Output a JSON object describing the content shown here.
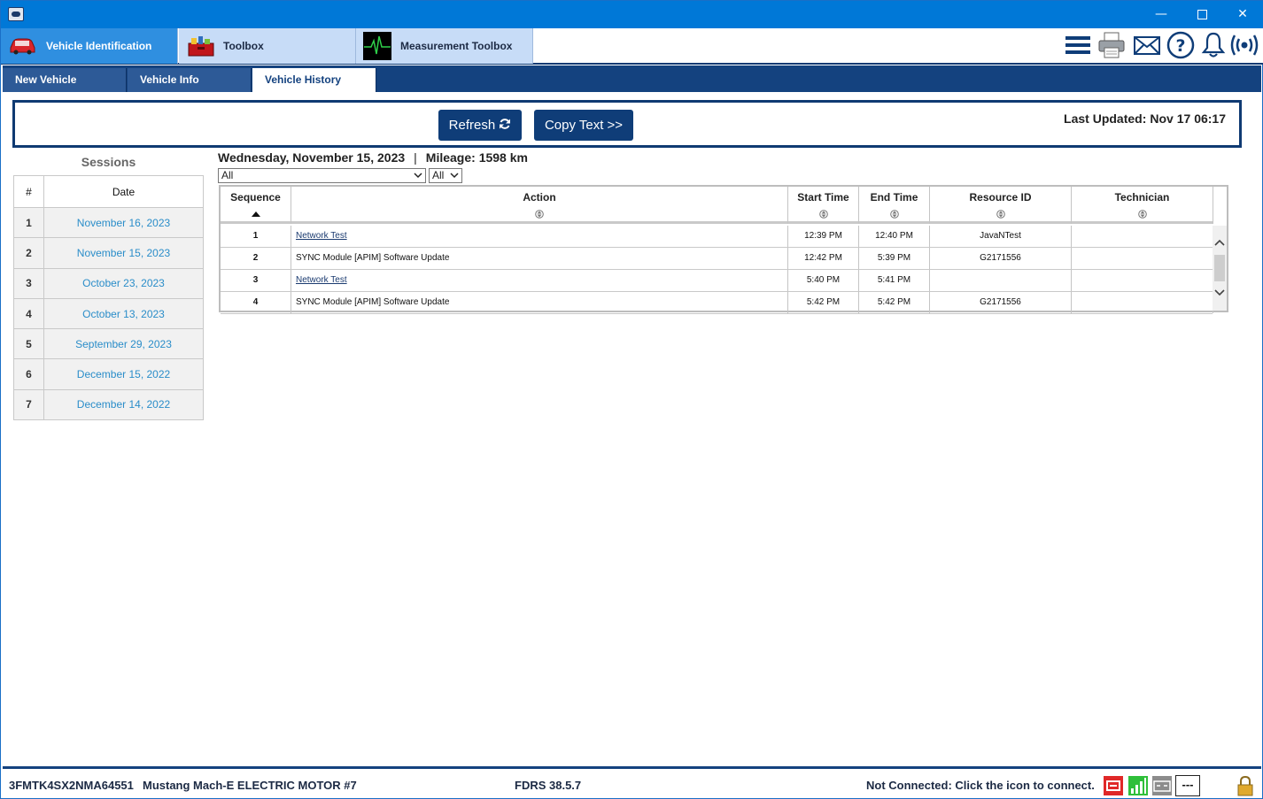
{
  "window": {
    "minimize": "—",
    "close": "✕"
  },
  "main_tabs": [
    {
      "label": "Vehicle Identification",
      "icon": "car-icon",
      "active": true
    },
    {
      "label": "Toolbox",
      "icon": "toolbox-icon",
      "active": false
    },
    {
      "label": "Measurement Toolbox",
      "icon": "ecg-icon",
      "active": false
    }
  ],
  "top_icons": [
    "menu-icon",
    "printer-icon",
    "mail-icon",
    "help-icon",
    "bell-icon",
    "wireless-icon"
  ],
  "sub_tabs": [
    {
      "label": "New Vehicle",
      "active": false
    },
    {
      "label": "Vehicle Info",
      "active": false
    },
    {
      "label": "Vehicle History",
      "active": true
    }
  ],
  "toolbar": {
    "refresh_label": "Refresh",
    "copy_label": "Copy Text >>",
    "last_updated_label": "Last Updated:",
    "last_updated_value": "Nov 17 06:17"
  },
  "sessions": {
    "title": "Sessions",
    "col_num": "#",
    "col_date": "Date",
    "rows": [
      {
        "num": "1",
        "date": "November 16, 2023"
      },
      {
        "num": "2",
        "date": "November 15, 2023"
      },
      {
        "num": "3",
        "date": "October 23, 2023"
      },
      {
        "num": "4",
        "date": "October 13, 2023"
      },
      {
        "num": "5",
        "date": "September 29, 2023"
      },
      {
        "num": "6",
        "date": "December 15, 2022"
      },
      {
        "num": "7",
        "date": "December 14, 2022"
      }
    ]
  },
  "detail": {
    "date": "Wednesday, November 15, 2023",
    "separator": "|",
    "mileage": "Mileage: 1598 km",
    "filter1": "All",
    "filter2": "All"
  },
  "history": {
    "columns": [
      "Sequence",
      "Action",
      "Start Time",
      "End Time",
      "Resource ID",
      "Technician"
    ],
    "rows": [
      {
        "seq": "1",
        "action": "Network Test",
        "link": true,
        "start": "12:39 PM",
        "end": "12:40 PM",
        "resource": "JavaNTest",
        "tech": ""
      },
      {
        "seq": "2",
        "action": "SYNC Module [APIM] Software Update",
        "link": false,
        "start": "12:42 PM",
        "end": "5:39 PM",
        "resource": "G2171556",
        "tech": ""
      },
      {
        "seq": "3",
        "action": "Network Test",
        "link": true,
        "start": "5:40 PM",
        "end": "5:41 PM",
        "resource": "",
        "tech": ""
      },
      {
        "seq": "4",
        "action": "SYNC Module [APIM] Software Update",
        "link": false,
        "start": "5:42 PM",
        "end": "5:42 PM",
        "resource": "G2171556",
        "tech": ""
      }
    ]
  },
  "status": {
    "vin": "3FMTK4SX2NMA64551",
    "model": "Mustang Mach-E ELECTRIC MOTOR #7",
    "version": "FDRS 38.5.7",
    "connection": "Not Connected: Click the icon to connect.",
    "icons": [
      "vci-icon",
      "signal-icon",
      "battery-icon",
      "dashes-icon",
      "lock-icon"
    ],
    "dashes": "---"
  }
}
